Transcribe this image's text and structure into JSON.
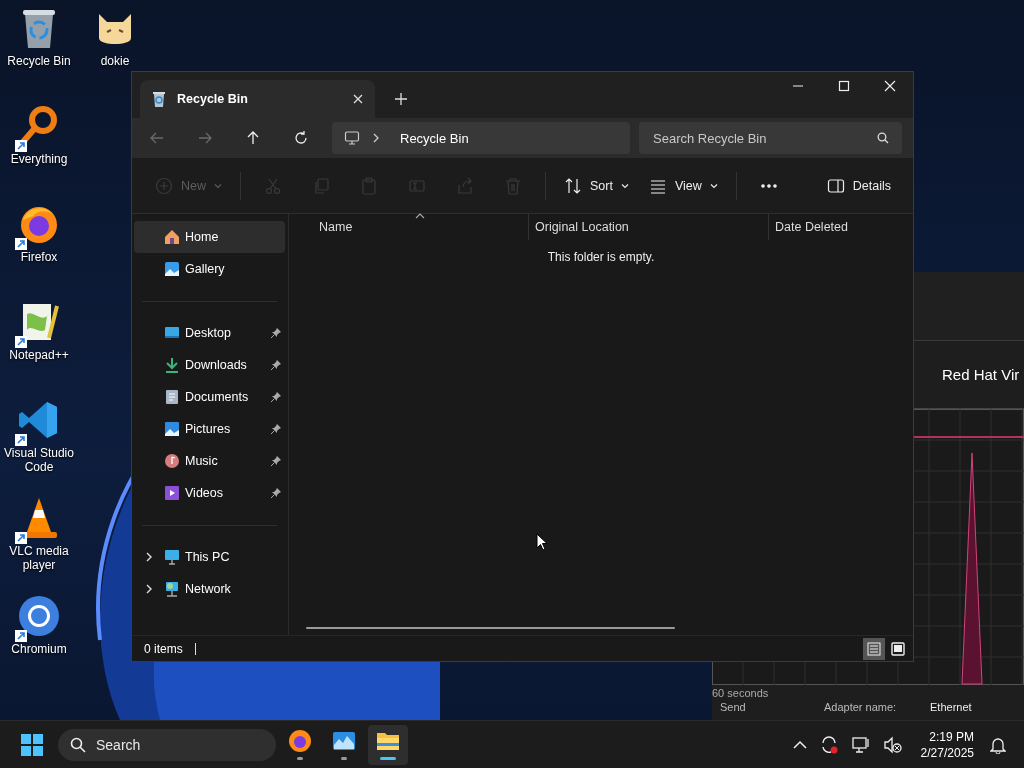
{
  "desktop": {
    "icon_columns": [
      {
        "icons": [
          {
            "label": "Recycle Bin",
            "shortcut": false
          },
          {
            "label": "Everything",
            "shortcut": true
          },
          {
            "label": "Firefox",
            "shortcut": true
          },
          {
            "label": "Notepad++",
            "shortcut": true
          },
          {
            "label": "Visual Studio Code",
            "shortcut": true
          },
          {
            "label": "VLC media player",
            "shortcut": true
          },
          {
            "label": "Chromium",
            "shortcut": true
          }
        ]
      },
      {
        "icons": [
          {
            "label": "dokie",
            "shortcut": false
          }
        ]
      }
    ]
  },
  "background_window": {
    "title": "Red Hat Vir",
    "graph_caption": "60 seconds",
    "details": [
      {
        "label": "Send"
      },
      {
        "label": "Adapter name:"
      },
      {
        "label": "Ethernet"
      }
    ]
  },
  "explorer": {
    "tab": {
      "title": "Recycle Bin"
    },
    "nav_buttons": [
      {
        "disabled": true
      },
      {
        "disabled": true
      },
      {
        "disabled": false
      },
      {
        "disabled": false
      }
    ],
    "address": {
      "path": "Recycle Bin"
    },
    "search": {
      "placeholder": "Search Recycle Bin"
    },
    "commands": [
      {
        "label": "New",
        "disabled": true,
        "dropdown": true
      },
      {
        "disabled": true
      },
      {
        "disabled": true
      },
      {
        "disabled": true
      },
      {
        "disabled": true
      },
      {
        "disabled": true
      },
      {
        "disabled": true
      },
      {
        "label": "Sort",
        "disabled": false,
        "dropdown": true
      },
      {
        "label": "View",
        "disabled": false,
        "dropdown": true
      },
      {
        "disabled": false
      },
      {
        "label": "Details",
        "disabled": false
      }
    ],
    "sidebar": {
      "groups": [
        {
          "items": [
            {
              "label": "Home",
              "selected": true
            },
            {
              "label": "Gallery",
              "selected": false
            }
          ]
        },
        {
          "items": [
            {
              "label": "Desktop",
              "selected": false,
              "pinned": true
            },
            {
              "label": "Downloads",
              "selected": false,
              "pinned": true
            },
            {
              "label": "Documents",
              "selected": false,
              "pinned": true
            },
            {
              "label": "Pictures",
              "selected": false,
              "pinned": true
            },
            {
              "label": "Music",
              "selected": false,
              "pinned": true
            },
            {
              "label": "Videos",
              "selected": false,
              "pinned": true
            }
          ]
        },
        {
          "items": [
            {
              "label": "This PC",
              "selected": false,
              "expanded": false
            },
            {
              "label": "Network",
              "selected": false,
              "expanded": false
            }
          ]
        }
      ]
    },
    "columns": [
      {
        "label": "Name",
        "sorted": true
      },
      {
        "label": "Original Location",
        "sorted": false
      },
      {
        "label": "Date Deleted",
        "sorted": false
      }
    ],
    "empty_message": "This folder is empty.",
    "status": "0 items",
    "view_modes": [
      {
        "selected": true
      },
      {
        "selected": false
      }
    ]
  },
  "taskbar": {
    "search": {
      "placeholder": "Search"
    },
    "apps": [
      {
        "active": false
      },
      {
        "active": false
      },
      {
        "active": true
      }
    ],
    "clock": {
      "time": "2:19 PM",
      "date": "2/27/2025"
    }
  }
}
